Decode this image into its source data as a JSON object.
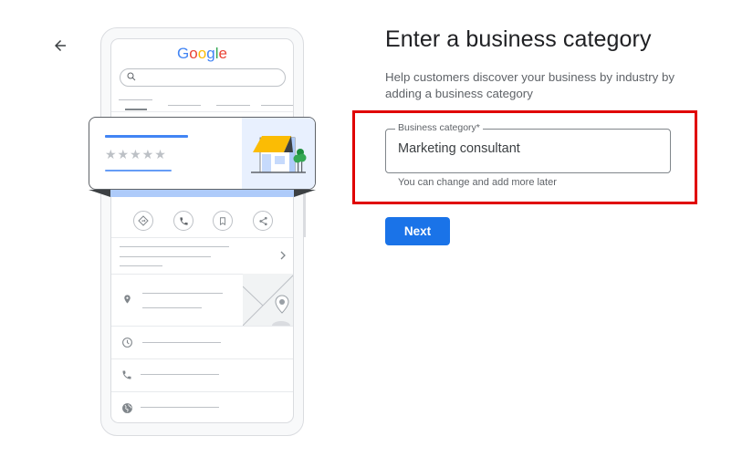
{
  "nav": {
    "back_icon": "arrow-left-icon"
  },
  "illustration": {
    "logo_letters": [
      {
        "char": "G",
        "color": "#4285f4"
      },
      {
        "char": "o",
        "color": "#ea4335"
      },
      {
        "char": "o",
        "color": "#fbbc05"
      },
      {
        "char": "g",
        "color": "#4285f4"
      },
      {
        "char": "l",
        "color": "#34a853"
      },
      {
        "char": "e",
        "color": "#ea4335"
      }
    ],
    "stars": "★★★★★",
    "action_icons": [
      "directions-icon",
      "phone-icon",
      "bookmark-icon",
      "share-icon"
    ],
    "row_icons": [
      "location-pin-icon",
      "clock-icon",
      "phone-icon",
      "globe-icon"
    ],
    "colors": {
      "awning": "#fbbc04",
      "tree": "#34a853",
      "card_accent": "#4285f4",
      "card_band": "#aecbfa"
    }
  },
  "form": {
    "title": "Enter a business category",
    "subtitle": "Help customers discover your business by industry by adding a business category",
    "field_label": "Business category*",
    "field_value": "Marketing consultant",
    "helper_text": "You can change and add more later",
    "next_label": "Next"
  },
  "colors": {
    "primary": "#1a73e8",
    "highlight_border": "#e00000"
  }
}
